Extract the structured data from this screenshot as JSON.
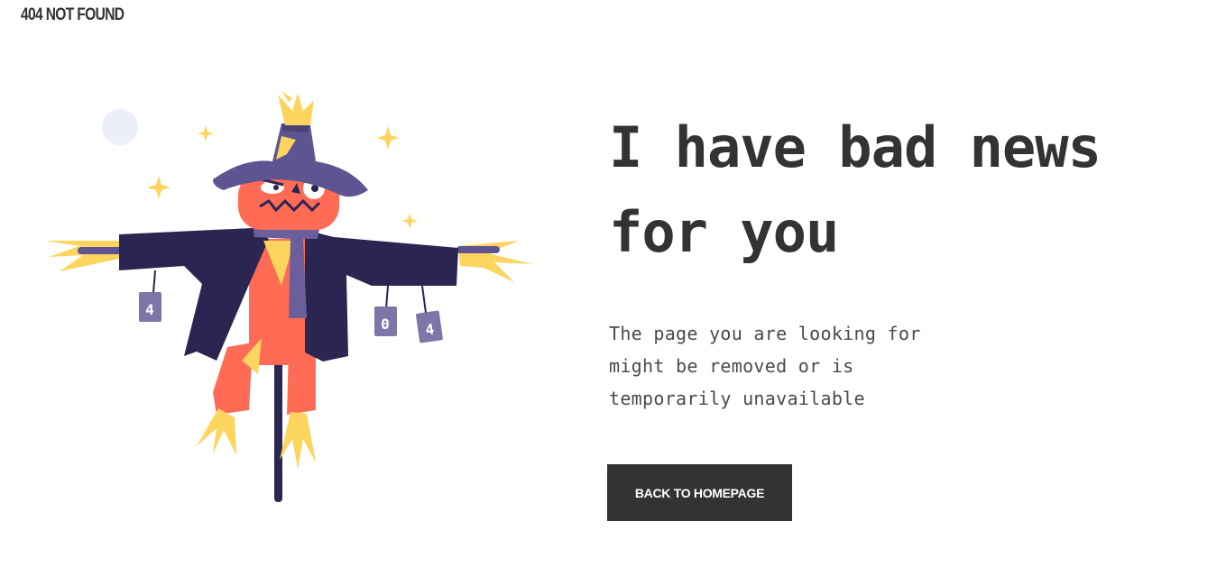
{
  "header": {
    "title": "404 NOT FOUND"
  },
  "main": {
    "headline": "I have bad news for you",
    "description": "The page you are looking for might be removed or is temporarily unavailable",
    "button_label": "BACK TO HOMEPAGE"
  },
  "illustration": {
    "can_labels": [
      "4",
      "0",
      "4"
    ],
    "colors": {
      "hat": "#5d5491",
      "coat": "#2b2551",
      "face": "#ff6b54",
      "straw": "#fdd45e",
      "scarf": "#6a5f9b",
      "can": "#7e76a8",
      "moon": "#eceffa"
    }
  }
}
